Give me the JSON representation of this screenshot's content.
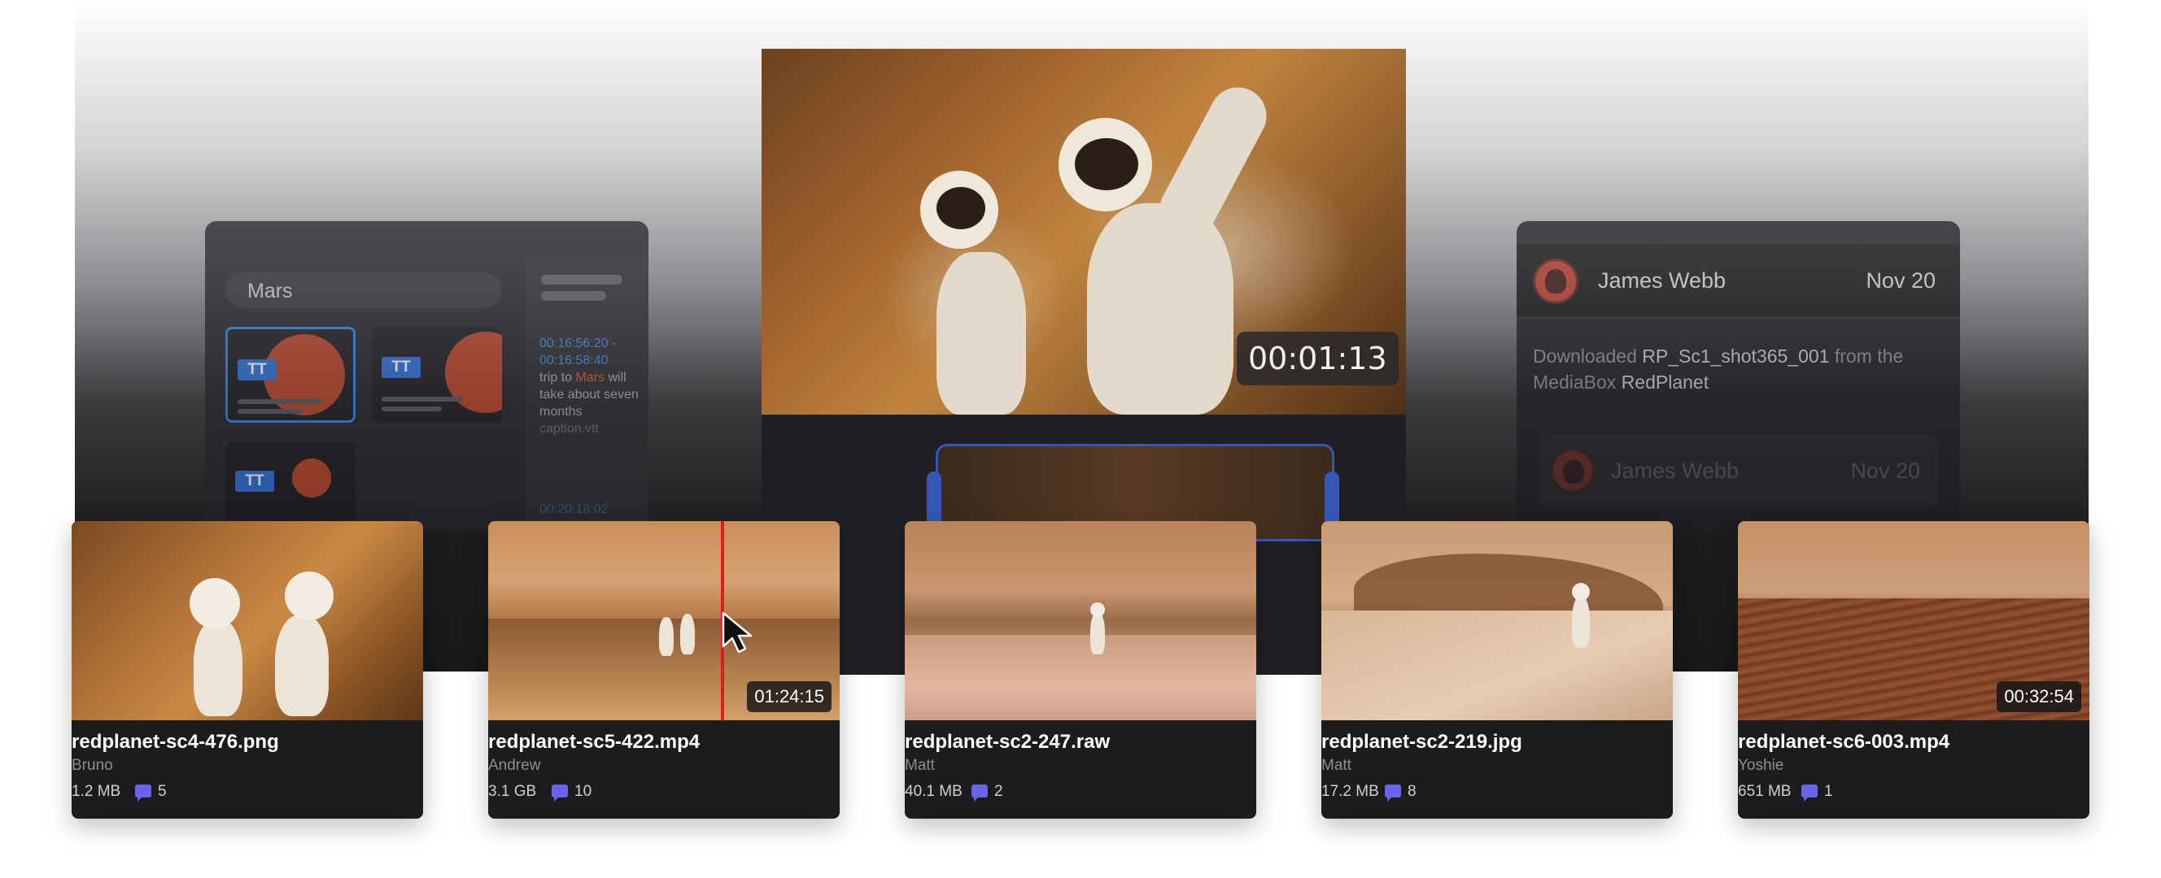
{
  "search_panel": {
    "query": "Mars",
    "thumb_badge_1": "TT",
    "thumb_badge_2": "TT",
    "thumb_badge_3": "TT",
    "caption_timecode": "00:16:56:20 - 00:16:58:40",
    "caption_text_before": "trip to ",
    "caption_highlight": "Mars",
    "caption_text_after": " will take about seven months",
    "caption_source": "caption.vtt",
    "caption_timecode_2": "00:20:18:02"
  },
  "activity_panel": {
    "user": "James Webb",
    "date": "Nov 20",
    "message_prefix": "Downloaded ",
    "message_file": "RP_Sc1_shot365_001",
    "message_middle": " from the MediaBox ",
    "message_box": "RedPlanet",
    "second_user": "James Webb",
    "second_date": "Nov 20"
  },
  "player": {
    "timecode": "00:01:13"
  },
  "assets": [
    {
      "title": "redplanet-sc4-476.png",
      "author": "Bruno",
      "size": "1.2 MB",
      "comments": "5",
      "duration": ""
    },
    {
      "title": "redplanet-sc5-422.mp4",
      "author": "Andrew",
      "size": "3.1 GB",
      "comments": "10",
      "duration": "01:24:15"
    },
    {
      "title": "redplanet-sc2-247.raw",
      "author": "Matt",
      "size": "40.1 MB",
      "comments": "2",
      "duration": ""
    },
    {
      "title": "redplanet-sc2-219.jpg",
      "author": "Matt",
      "size": "17.2 MB",
      "comments": "8",
      "duration": ""
    },
    {
      "title": "redplanet-sc6-003.mp4",
      "author": "Yoshie",
      "size": "651 MB",
      "comments": "1",
      "duration": "00:32:54"
    }
  ],
  "colors": {
    "accent_comment": "#6b63e8",
    "scrub_line": "#e31b1b",
    "selection_blue": "#2d7fe6"
  }
}
